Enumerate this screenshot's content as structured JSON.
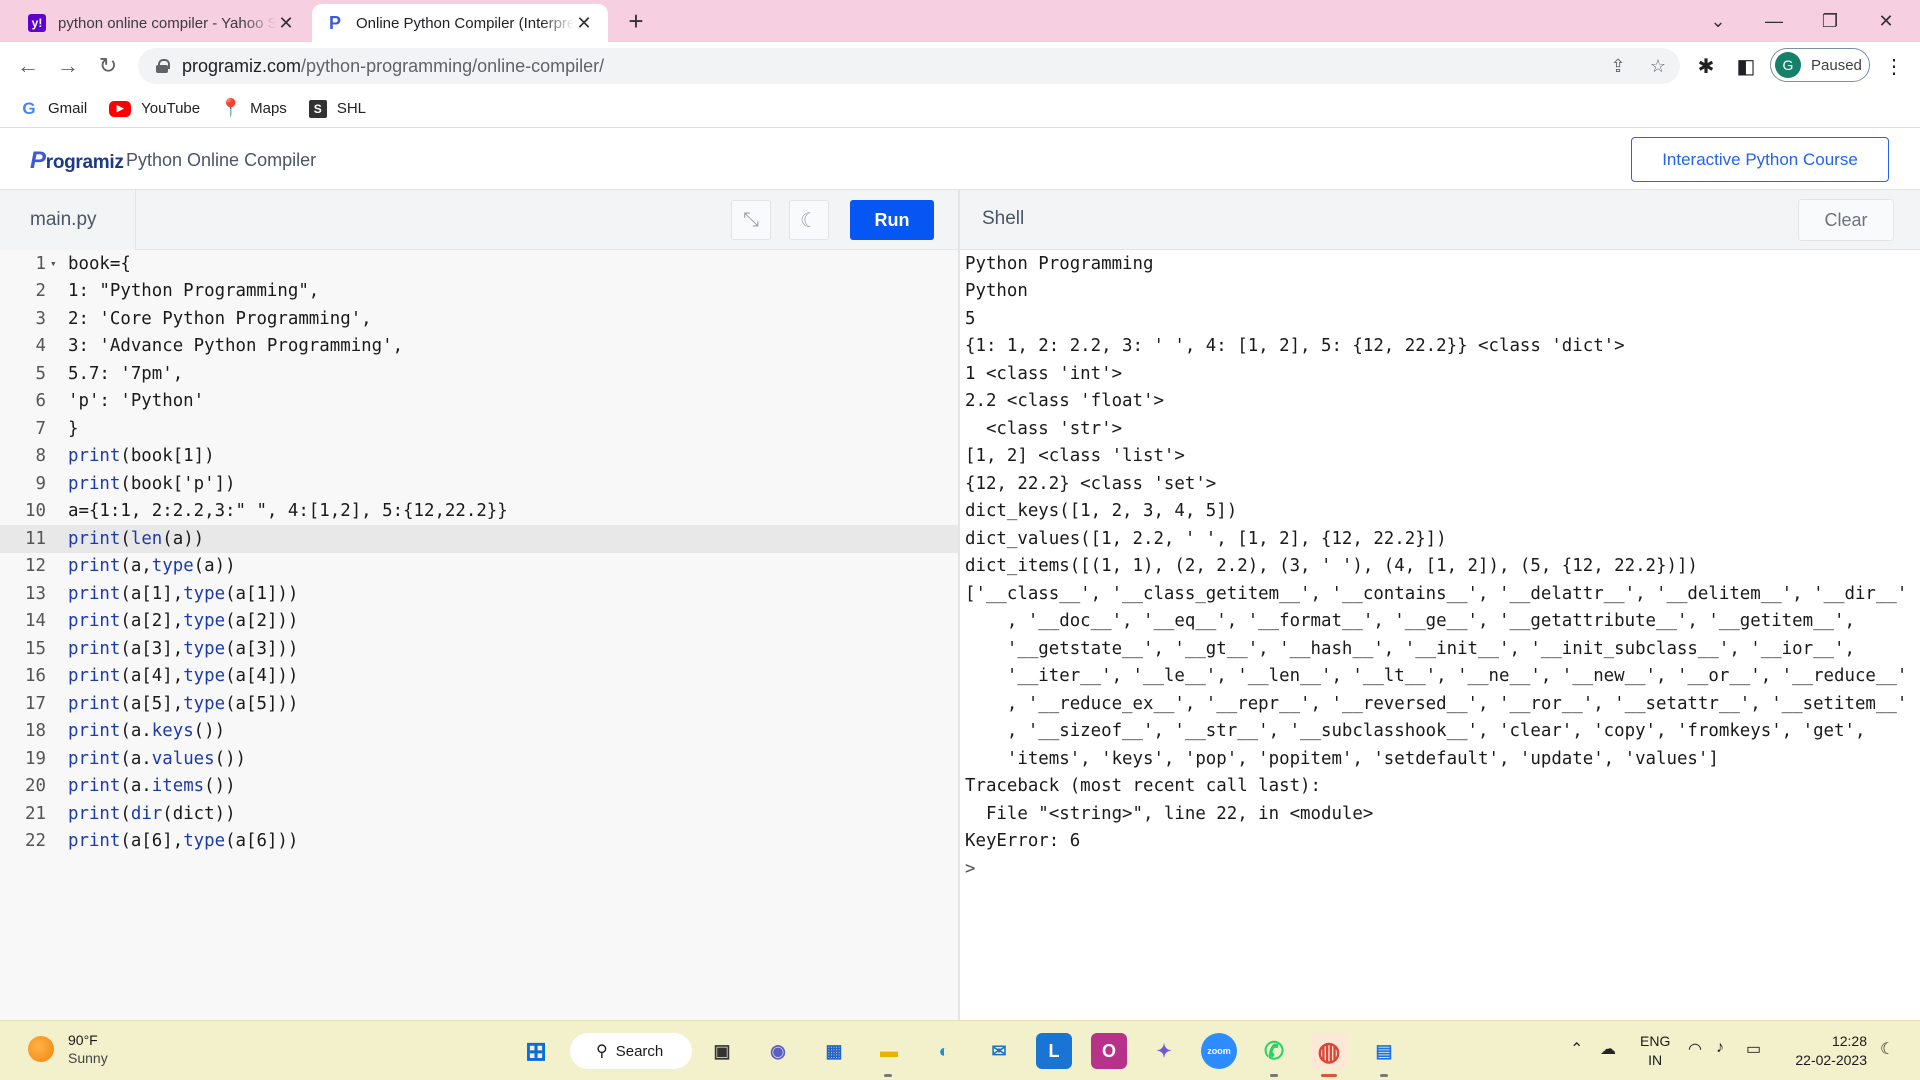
{
  "browser": {
    "tabs": [
      {
        "title": "python online compiler - Yahoo Search Results",
        "favicon": "yahoo-icon"
      },
      {
        "title": "Online Python Compiler (Interpreter)",
        "favicon": "programiz-icon"
      }
    ],
    "url_host": "programiz.com",
    "url_path": "/python-programming/online-compiler/",
    "profile_initial": "G",
    "profile_status": "Paused",
    "bookmarks": [
      {
        "label": "Gmail",
        "icon": "google-icon"
      },
      {
        "label": "YouTube",
        "icon": "youtube-icon"
      },
      {
        "label": "Maps",
        "icon": "maps-icon"
      },
      {
        "label": "SHL",
        "icon": "shl-icon"
      }
    ]
  },
  "app": {
    "logo": "Programiz",
    "title": "Python Online Compiler",
    "course_button": "Interactive Python Course"
  },
  "editor": {
    "file_name": "main.py",
    "run_label": "Run",
    "active_line": 11,
    "lines": [
      "book={",
      "1: \"Python Programming\",",
      "2: 'Core Python Programming',",
      "3: 'Advance Python Programming',",
      "5.7: '7pm',",
      "'p': 'Python'",
      "}",
      "print(book[1])",
      "print(book['p'])",
      "a={1:1, 2:2.2,3:\" \", 4:[1,2], 5:{12,22.2}}",
      "print(len(a))",
      "print(a,type(a))",
      "print(a[1],type(a[1]))",
      "print(a[2],type(a[2]))",
      "print(a[3],type(a[3]))",
      "print(a[4],type(a[4]))",
      "print(a[5],type(a[5]))",
      "print(a.keys())",
      "print(a.values())",
      "print(a.items())",
      "print(dir(dict))",
      "print(a[6],type(a[6]))"
    ]
  },
  "shell": {
    "title": "Shell",
    "clear_label": "Clear",
    "output": [
      "Python Programming",
      "Python",
      "5",
      "{1: 1, 2: 2.2, 3: ' ', 4: [1, 2], 5: {12, 22.2}} <class 'dict'>",
      "1 <class 'int'>",
      "2.2 <class 'float'>",
      "  <class 'str'>",
      "[1, 2] <class 'list'>",
      "{12, 22.2} <class 'set'>",
      "dict_keys([1, 2, 3, 4, 5])",
      "dict_values([1, 2.2, ' ', [1, 2], {12, 22.2}])",
      "dict_items([(1, 1), (2, 2.2), (3, ' '), (4, [1, 2]), (5, {12, 22.2})])",
      "['__class__', '__class_getitem__', '__contains__', '__delattr__', '__delitem__', '__dir__'",
      "    , '__doc__', '__eq__', '__format__', '__ge__', '__getattribute__', '__getitem__',",
      "    '__getstate__', '__gt__', '__hash__', '__init__', '__init_subclass__', '__ior__',",
      "    '__iter__', '__le__', '__len__', '__lt__', '__ne__', '__new__', '__or__', '__reduce__'",
      "    , '__reduce_ex__', '__repr__', '__reversed__', '__ror__', '__setattr__', '__setitem__'",
      "    , '__sizeof__', '__str__', '__subclasshook__', 'clear', 'copy', 'fromkeys', 'get',",
      "    'items', 'keys', 'pop', 'popitem', 'setdefault', 'update', 'values']",
      "Traceback (most recent call last):",
      "  File \"<string>\", line 22, in <module>",
      "KeyError: 6",
      ">"
    ]
  },
  "taskbar": {
    "temperature": "90°F",
    "condition": "Sunny",
    "search_label": "Search",
    "lang_line1": "ENG",
    "lang_line2": "IN",
    "time": "12:28",
    "date": "22-02-2023"
  }
}
